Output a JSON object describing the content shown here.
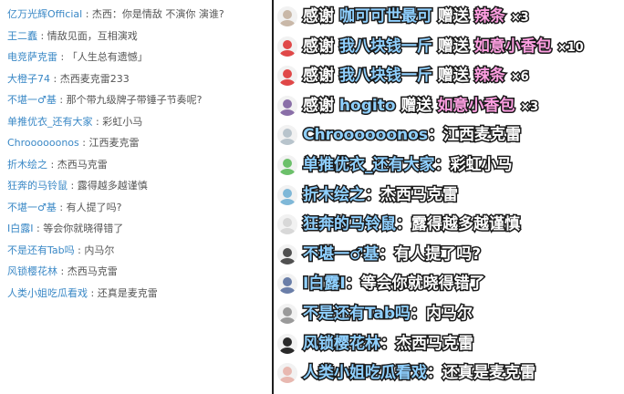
{
  "left_chat": [
    {
      "user": "亿万光辉Official",
      "sep": " : ",
      "msg": "杰西：你是情敌 不演你 演谁?"
    },
    {
      "user": "王二蠢",
      "sep": " : ",
      "msg": "情敌见面，互相演戏"
    },
    {
      "user": "电竞萨克雷",
      "sep": " : ",
      "msg": "「人生总有遗憾」"
    },
    {
      "user": "大橙子74",
      "sep": " : ",
      "msg": "杰西麦克雷233"
    },
    {
      "user": "不堪一♂基",
      "sep": " : ",
      "msg": "那个带九级牌子带锤子节奏呢?"
    },
    {
      "user": "单推优衣_还有大家",
      "sep": " : ",
      "msg": "彩虹小马"
    },
    {
      "user": "Chroooooonos",
      "sep": " : ",
      "msg": "江西麦克雷"
    },
    {
      "user": "折木绘之",
      "sep": " : ",
      "msg": "杰西马克雷"
    },
    {
      "user": "狂奔的马铃鼠",
      "sep": " : ",
      "msg": "露得越多越谨慎"
    },
    {
      "user": "不堪一♂基",
      "sep": " : ",
      "msg": "有人提了吗?"
    },
    {
      "user": "I白露I",
      "sep": " : ",
      "msg": "等会你就晓得错了"
    },
    {
      "user": "不是还有Tab吗",
      "sep": " : ",
      "msg": "内马尔"
    },
    {
      "user": "风锁樱花林",
      "sep": " : ",
      "msg": "杰西马克雷"
    },
    {
      "user": "人类小姐吃瓜看戏",
      "sep": " : ",
      "msg": "还真是麦克雷"
    }
  ],
  "gifts": [
    {
      "thanks": "感谢",
      "user": "咖可可世最可",
      "gave": "赠送",
      "gift": "辣条",
      "count": "×3",
      "avatar_color": "#c9b8a8"
    },
    {
      "thanks": "感谢",
      "user": "我八块钱一斤",
      "gave": "赠送",
      "gift": "如意小香包",
      "count": "×10",
      "avatar_color": "#e04848"
    },
    {
      "thanks": "感谢",
      "user": "我八块钱一斤",
      "gave": "赠送",
      "gift": "辣条",
      "count": "×6",
      "avatar_color": "#e04848"
    },
    {
      "thanks": "感谢",
      "user": "hogito",
      "gave": "赠送",
      "gift": "如意小香包",
      "count": "×3",
      "avatar_color": "#8a6fa8"
    }
  ],
  "danmaku": [
    {
      "user": "Chroooooonos",
      "sep": "：",
      "msg": "江西麦克雷",
      "avatar_color": "#b8c4cc"
    },
    {
      "user": "单推优衣_还有大家",
      "sep": "：",
      "msg": "彩虹小马",
      "avatar_color": "#6cc06a"
    },
    {
      "user": "折木绘之",
      "sep": "：",
      "msg": "杰西马克雷",
      "avatar_color": "#7fb8d8"
    },
    {
      "user": "狂奔的马铃鼠",
      "sep": "：",
      "msg": "露得越多越谨慎",
      "avatar_color": "#d8d8d8"
    },
    {
      "user": "不堪一♂基",
      "sep": "：",
      "msg": "有人提了吗?",
      "avatar_color": "#505050"
    },
    {
      "user": "I白露I",
      "sep": "：",
      "msg": "等会你就晓得错了",
      "avatar_color": "#6a7ea8"
    },
    {
      "user": "不是还有Tab吗",
      "sep": "：",
      "msg": "内马尔",
      "avatar_color": "#9a9a9a"
    },
    {
      "user": "风锁樱花林",
      "sep": "：",
      "msg": "杰西马克雷",
      "avatar_color": "#2a2a2a"
    },
    {
      "user": "人类小姐吃瓜看戏",
      "sep": "：",
      "msg": "还真是麦克雷",
      "avatar_color": "#e8b8b0"
    }
  ],
  "colors": {
    "left_name": "#3a88c6",
    "name_blue": "#8fd0ff",
    "gift_pink": "#ff9fe2"
  }
}
